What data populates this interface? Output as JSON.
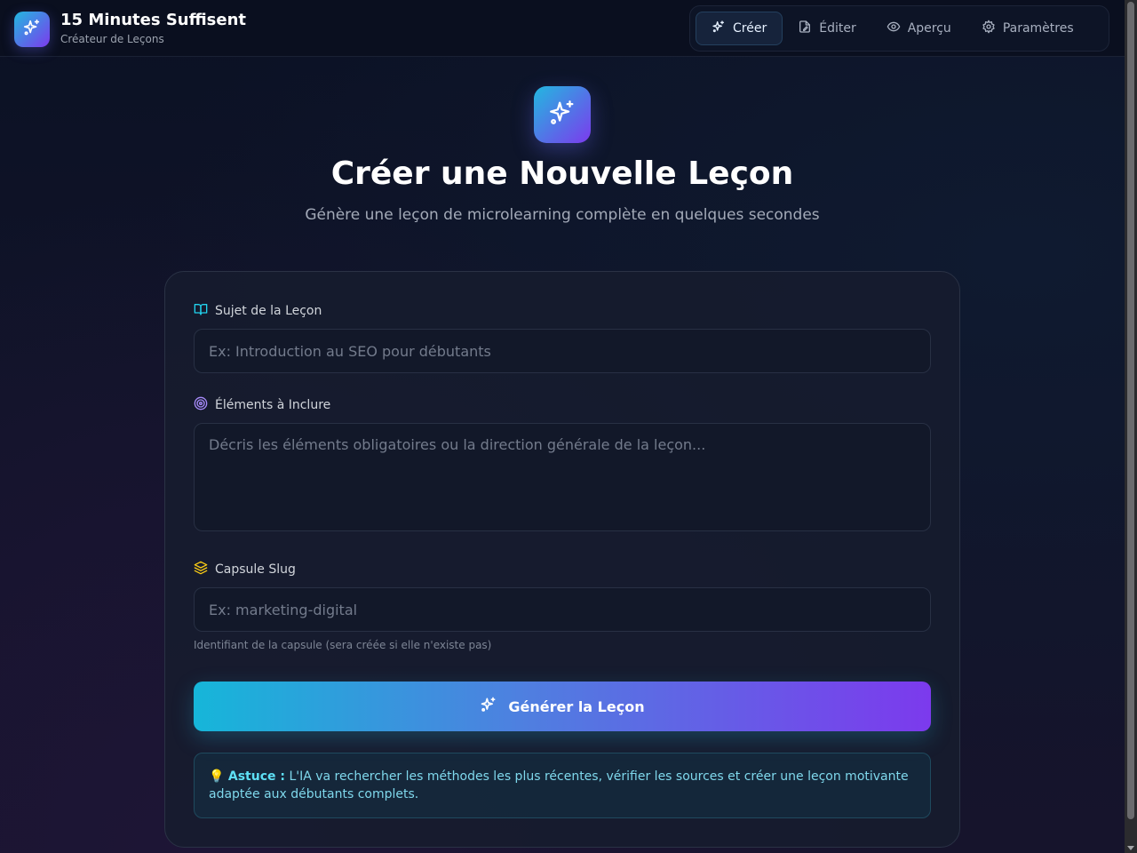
{
  "app": {
    "title": "15 Minutes Suffisent",
    "subtitle": "Créateur de Leçons",
    "logo_icon": "sparkles-icon"
  },
  "nav": {
    "items": [
      {
        "label": "Créer",
        "icon": "sparkles-icon",
        "active": true
      },
      {
        "label": "Éditer",
        "icon": "file-edit-icon",
        "active": false
      },
      {
        "label": "Aperçu",
        "icon": "eye-icon",
        "active": false
      },
      {
        "label": "Paramètres",
        "icon": "gear-icon",
        "active": false
      }
    ]
  },
  "hero": {
    "title": "Créer une Nouvelle Leçon",
    "subtitle": "Génère une leçon de microlearning complète en quelques secondes"
  },
  "form": {
    "subject": {
      "label": "Sujet de la Leçon",
      "placeholder": "Ex: Introduction au SEO pour débutants",
      "value": ""
    },
    "elements": {
      "label": "Éléments à Inclure",
      "placeholder": "Décris les éléments obligatoires ou la direction générale de la leçon...",
      "value": ""
    },
    "slug": {
      "label": "Capsule Slug",
      "placeholder": "Ex: marketing-digital",
      "value": "",
      "hint": "Identifiant de la capsule (sera créée si elle n'existe pas)"
    },
    "submit_label": "Générer la Leçon"
  },
  "tip": {
    "emoji": "💡",
    "title": "Astuce :",
    "text": "L'IA va rechercher les méthodes les plus récentes, vérifier les sources et créer une leçon motivante adaptée aux débutants complets."
  },
  "colors": {
    "accent_start": "#22b8e0",
    "accent_end": "#7c3aed",
    "subject_icon": "#22d3ee",
    "elements_icon": "#a78bfa",
    "slug_icon": "#facc15"
  }
}
